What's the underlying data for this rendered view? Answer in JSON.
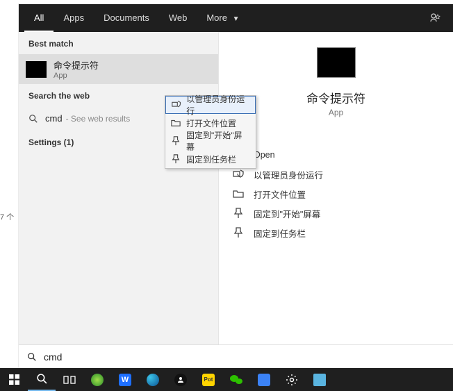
{
  "bg_fragment": "7 个",
  "tabs": {
    "all": "All",
    "apps": "Apps",
    "documents": "Documents",
    "web": "Web",
    "more": "More"
  },
  "left": {
    "best_match": "Best match",
    "result_title": "命令提示符",
    "result_sub": "App",
    "search_web": "Search the web",
    "web_query": "cmd",
    "web_hint": "- See web results",
    "settings": "Settings (1)"
  },
  "context_menu": {
    "run_admin": "以管理员身份运行",
    "open_location": "打开文件位置",
    "pin_start": "固定到\"开始\"屏幕",
    "pin_taskbar": "固定到任务栏"
  },
  "preview": {
    "title": "命令提示符",
    "sub": "App"
  },
  "actions": {
    "open": "Open",
    "run_admin": "以管理员身份运行",
    "open_location": "打开文件位置",
    "pin_start": "固定到\"开始\"屏幕",
    "pin_taskbar": "固定到任务栏"
  },
  "search_input": "cmd"
}
